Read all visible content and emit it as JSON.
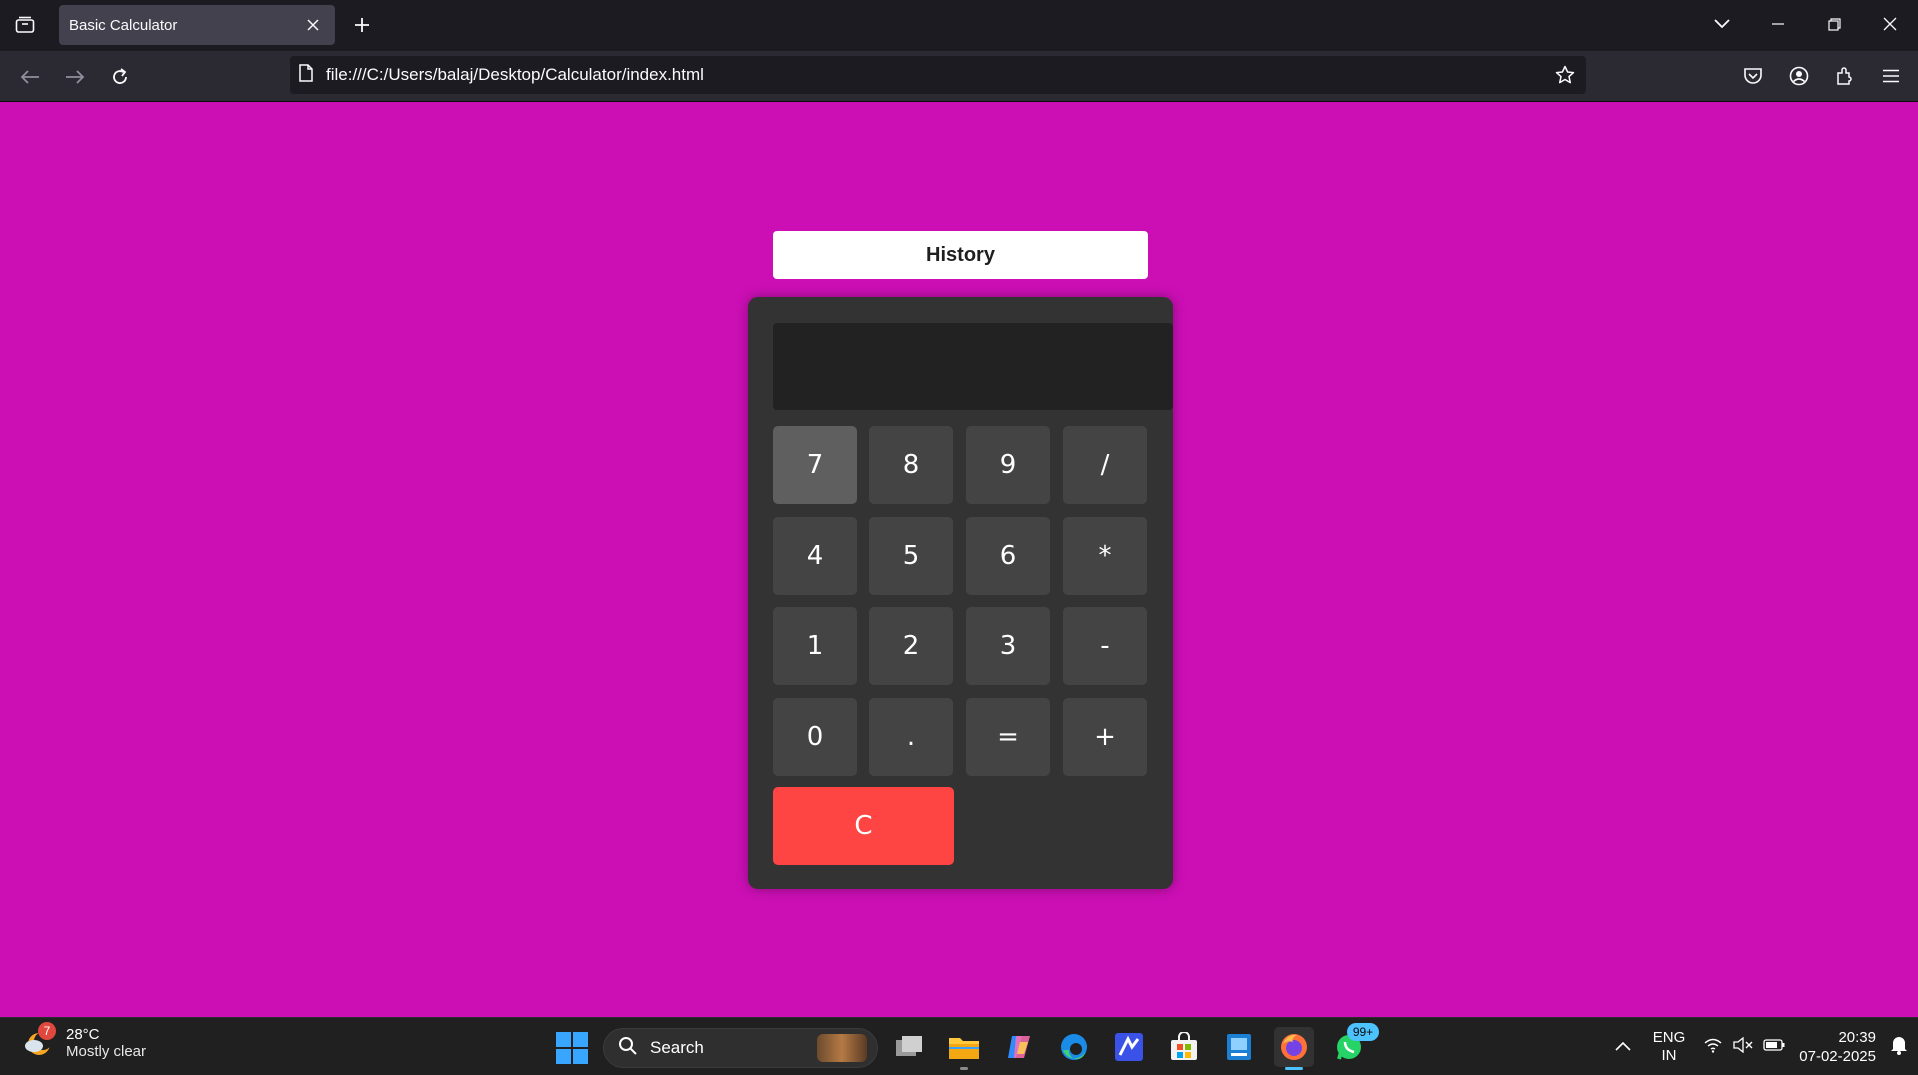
{
  "browser": {
    "tab_title": "Basic Calculator",
    "url": "file:///C:/Users/balaj/Desktop/Calculator/index.html"
  },
  "page": {
    "background_color": "#cc0fb5",
    "history_label": "History",
    "display_value": "",
    "keys": [
      "7",
      "8",
      "9",
      "/",
      "4",
      "5",
      "6",
      "*",
      "1",
      "2",
      "3",
      "-",
      "0",
      ".",
      "=",
      "+"
    ],
    "active_key": "7",
    "clear_label": "C",
    "clear_color": "#ff4444"
  },
  "taskbar": {
    "weather_temp": "28°C",
    "weather_desc": "Mostly clear",
    "weather_badge": "7",
    "search_label": "Search",
    "whatsapp_badge": "99+",
    "lang_line1": "ENG",
    "lang_line2": "IN",
    "time": "20:39",
    "date": "07-02-2025"
  }
}
